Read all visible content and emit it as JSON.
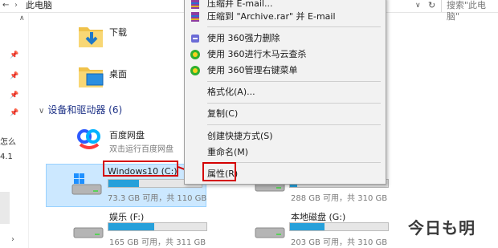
{
  "address_bar": {
    "back_arrow": "←",
    "separator": "›",
    "path": "此电脑",
    "dropdown_glyph": "∨",
    "refresh_glyph": "↻",
    "search_placeholder": "搜索\"此电脑\""
  },
  "nav": {
    "items": [
      "",
      "",
      "",
      "",
      "怎么",
      "4.1"
    ]
  },
  "folders": [
    {
      "label": "下载",
      "icon": "download-folder-icon"
    },
    {
      "label": "桌面",
      "icon": "desktop-folder-icon"
    }
  ],
  "section": {
    "title": "设备和驱动器 (6)",
    "chevron": "∨"
  },
  "apps": [
    {
      "label": "百度网盘",
      "sub": "双击运行百度网盘",
      "icon": "baidu-netdisk-icon"
    }
  ],
  "drives": [
    {
      "name": "Windows10 (C:)",
      "space": "73.3 GB 可用，共 110 GB",
      "used_fraction": 0.33,
      "selected": true
    },
    {
      "name": "",
      "space": "288 GB 可用，共 310 GB",
      "used_fraction": 0.07,
      "selected": false
    },
    {
      "name": "娱乐 (F:)",
      "space": "165 GB 可用，共 311 GB",
      "used_fraction": 0.47,
      "selected": false
    },
    {
      "name": "本地磁盘 (G:)",
      "space": "203 GB 可用，共 310 GB",
      "used_fraction": 0.35,
      "selected": false
    }
  ],
  "context_menu": {
    "items": [
      {
        "label": "压缩并 E-mail...",
        "icon": "winrar-icon"
      },
      {
        "label": "压缩到 \"Archive.rar\" 并 E-mail",
        "icon": "winrar-icon"
      },
      {
        "label": "使用 360强力删除",
        "icon": "360-delete-icon"
      },
      {
        "label": "使用 360进行木马云查杀",
        "icon": "360-scan-icon"
      },
      {
        "label": "使用 360管理右键菜单",
        "icon": "360-manage-icon"
      },
      {
        "label": "格式化(A)...",
        "icon": ""
      },
      {
        "label": "复制(C)",
        "icon": ""
      },
      {
        "label": "创建快捷方式(S)",
        "icon": ""
      },
      {
        "label": "重命名(M)",
        "icon": ""
      },
      {
        "label": "属性(R)",
        "icon": ""
      }
    ]
  },
  "watermark": "今日も明",
  "colors": {
    "accent_blue": "#26a0da",
    "selection": "#cce8ff",
    "highlight_red": "#d40000",
    "section_title": "#1e3287"
  }
}
